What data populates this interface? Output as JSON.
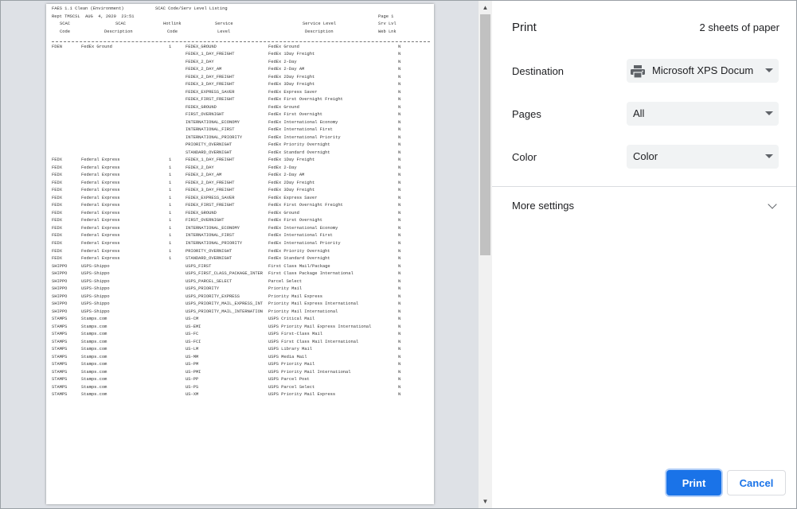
{
  "print_panel": {
    "title": "Print",
    "sheets": "2 sheets of paper",
    "destination": {
      "label": "Destination",
      "value": "Microsoft XPS Docum"
    },
    "pages": {
      "label": "Pages",
      "value": "All"
    },
    "color": {
      "label": "Color",
      "value": "Color"
    },
    "more_settings": "More settings",
    "print_button": "Print",
    "cancel_button": "Cancel"
  },
  "preview": {
    "header": {
      "line1_left": "FAES 1.1 Clean (Environment)",
      "line1_mid": "SCAC Code/Serv Level Listing",
      "line2_left": "Rept TMSCSL  AUG  4, 2020  23:51",
      "line2_right": "Page 1",
      "col1a": "SCAC",
      "col1b": "Code",
      "col2a": "SCAC",
      "col2b": "Description",
      "col3a": "Hotlink",
      "col3b": "Code",
      "col4a": "Service",
      "col4b": "Level",
      "col5a": "Service Level",
      "col5b": "Description",
      "col6a": "Srv Lvl",
      "col6b": "Web Lnk"
    },
    "rows": [
      {
        "code": "FDEN",
        "desc": "FedEx Ground",
        "hot": "1",
        "level": "FEDEX_GROUND",
        "sdesc": "FedEx Ground",
        "web": "N"
      },
      {
        "code": "",
        "desc": "",
        "hot": "",
        "level": "FEDEX_1_DAY_FREIGHT",
        "sdesc": "FedEx 1Day Freight",
        "web": "N"
      },
      {
        "code": "",
        "desc": "",
        "hot": "",
        "level": "FEDEX_2_DAY",
        "sdesc": "FedEx 2-Day",
        "web": "N"
      },
      {
        "code": "",
        "desc": "",
        "hot": "",
        "level": "FEDEX_2_DAY_AM",
        "sdesc": "FedEx 2-Day AM",
        "web": "N"
      },
      {
        "code": "",
        "desc": "",
        "hot": "",
        "level": "FEDEX_2_DAY_FREIGHT",
        "sdesc": "FedEx 2Day Freight",
        "web": "N"
      },
      {
        "code": "",
        "desc": "",
        "hot": "",
        "level": "FEDEX_3_DAY_FREIGHT",
        "sdesc": "FedEx 3Day Freight",
        "web": "N"
      },
      {
        "code": "",
        "desc": "",
        "hot": "",
        "level": "FEDEX_EXPRESS_SAVER",
        "sdesc": "FedEx Express Saver",
        "web": "N"
      },
      {
        "code": "",
        "desc": "",
        "hot": "",
        "level": "FEDEX_FIRST_FREIGHT",
        "sdesc": "FedEx First Overnight Freight",
        "web": "N"
      },
      {
        "code": "",
        "desc": "",
        "hot": "",
        "level": "FEDEX_GROUND",
        "sdesc": "FedEx Ground",
        "web": "N"
      },
      {
        "code": "",
        "desc": "",
        "hot": "",
        "level": "FIRST_OVERNIGHT",
        "sdesc": "FedEx First Overnight",
        "web": "N"
      },
      {
        "code": "",
        "desc": "",
        "hot": "",
        "level": "INTERNATIONAL_ECONOMY",
        "sdesc": "FedEx International Economy",
        "web": "N"
      },
      {
        "code": "",
        "desc": "",
        "hot": "",
        "level": "INTERNATIONAL_FIRST",
        "sdesc": "FedEx International First",
        "web": "N"
      },
      {
        "code": "",
        "desc": "",
        "hot": "",
        "level": "INTERNATIONAL_PRIORITY",
        "sdesc": "FedEx International Priority",
        "web": "N"
      },
      {
        "code": "",
        "desc": "",
        "hot": "",
        "level": "PRIORITY_OVERNIGHT",
        "sdesc": "FedEx Priority Overnight",
        "web": "N"
      },
      {
        "code": "",
        "desc": "",
        "hot": "",
        "level": "STANDARD_OVERNIGHT",
        "sdesc": "FedEx Standard Overnight",
        "web": "N"
      },
      {
        "code": "FEDX",
        "desc": "Federal Express",
        "hot": "1",
        "level": "FEDEX_1_DAY_FREIGHT",
        "sdesc": "FedEx 1Day Freight",
        "web": "N"
      },
      {
        "code": "FEDX",
        "desc": "Federal Express",
        "hot": "1",
        "level": "FEDEX_2_DAY",
        "sdesc": "FedEx 2-Day",
        "web": "N"
      },
      {
        "code": "FEDX",
        "desc": "Federal Express",
        "hot": "1",
        "level": "FEDEX_2_DAY_AM",
        "sdesc": "FedEx 2-Day AM",
        "web": "N"
      },
      {
        "code": "FEDX",
        "desc": "Federal Express",
        "hot": "1",
        "level": "FEDEX_2_DAY_FREIGHT",
        "sdesc": "FedEx 2Day Freight",
        "web": "N"
      },
      {
        "code": "FEDX",
        "desc": "Federal Express",
        "hot": "1",
        "level": "FEDEX_3_DAY_FREIGHT",
        "sdesc": "FedEx 3Day Freight",
        "web": "N"
      },
      {
        "code": "FEDX",
        "desc": "Federal Express",
        "hot": "1",
        "level": "FEDEX_EXPRESS_SAVER",
        "sdesc": "FedEx Express Saver",
        "web": "N"
      },
      {
        "code": "FEDX",
        "desc": "Federal Express",
        "hot": "1",
        "level": "FEDEX_FIRST_FREIGHT",
        "sdesc": "FedEx First Overnight Freight",
        "web": "N"
      },
      {
        "code": "FEDX",
        "desc": "Federal Express",
        "hot": "1",
        "level": "FEDEX_GROUND",
        "sdesc": "FedEx Ground",
        "web": "N"
      },
      {
        "code": "FEDX",
        "desc": "Federal Express",
        "hot": "1",
        "level": "FIRST_OVERNIGHT",
        "sdesc": "FedEx First Overnight",
        "web": "N"
      },
      {
        "code": "FEDX",
        "desc": "Federal Express",
        "hot": "1",
        "level": "INTERNATIONAL_ECONOMY",
        "sdesc": "FedEx International Economy",
        "web": "N"
      },
      {
        "code": "FEDX",
        "desc": "Federal Express",
        "hot": "1",
        "level": "INTERNATIONAL_FIRST",
        "sdesc": "FedEx International First",
        "web": "N"
      },
      {
        "code": "FEDX",
        "desc": "Federal Express",
        "hot": "1",
        "level": "INTERNATIONAL_PRIORITY",
        "sdesc": "FedEx International Priority",
        "web": "N"
      },
      {
        "code": "FEDX",
        "desc": "Federal Express",
        "hot": "1",
        "level": "PRIORITY_OVERNIGHT",
        "sdesc": "FedEx Priority Overnight",
        "web": "N"
      },
      {
        "code": "FEDX",
        "desc": "Federal Express",
        "hot": "1",
        "level": "STANDARD_OVERNIGHT",
        "sdesc": "FedEx Standard Overnight",
        "web": "N"
      },
      {
        "code": "SHIPPO",
        "desc": "USPS-Shippo",
        "hot": "",
        "level": "USPS_FIRST",
        "sdesc": "First Class Mail/Package",
        "web": "N"
      },
      {
        "code": "SHIPPO",
        "desc": "USPS-Shippo",
        "hot": "",
        "level": "USPS_FIRST_CLASS_PACKAGE_INTER",
        "sdesc": "First Class Package International",
        "web": "N"
      },
      {
        "code": "SHIPPO",
        "desc": "USPS-Shippo",
        "hot": "",
        "level": "USPS_PARCEL_SELECT",
        "sdesc": "Parcel Select",
        "web": "N"
      },
      {
        "code": "SHIPPO",
        "desc": "USPS-Shippo",
        "hot": "",
        "level": "USPS_PRIORITY",
        "sdesc": "Priority Mail",
        "web": "N"
      },
      {
        "code": "SHIPPO",
        "desc": "USPS-Shippo",
        "hot": "",
        "level": "USPS_PRIORITY_EXPRESS",
        "sdesc": "Priority Mail Express",
        "web": "N"
      },
      {
        "code": "SHIPPO",
        "desc": "USPS-Shippo",
        "hot": "",
        "level": "USPS_PRIORITY_MAIL_EXPRESS_INT",
        "sdesc": "Priority Mail Express International",
        "web": "N"
      },
      {
        "code": "SHIPPO",
        "desc": "USPS-Shippo",
        "hot": "",
        "level": "USPS_PRIORITY_MAIL_INTERNATION",
        "sdesc": "Priority Mail International",
        "web": "N"
      },
      {
        "code": "STAMPS",
        "desc": "Stamps.com",
        "hot": "",
        "level": "US-CM",
        "sdesc": "USPS Critical Mail",
        "web": "N"
      },
      {
        "code": "STAMPS",
        "desc": "Stamps.com",
        "hot": "",
        "level": "US-EMI",
        "sdesc": "USPS Priority Mail Express International",
        "web": "N"
      },
      {
        "code": "STAMPS",
        "desc": "Stamps.com",
        "hot": "",
        "level": "US-FC",
        "sdesc": "USPS First-Class Mail",
        "web": "N"
      },
      {
        "code": "STAMPS",
        "desc": "Stamps.com",
        "hot": "",
        "level": "US-FCI",
        "sdesc": "USPS First Class Mail International",
        "web": "N"
      },
      {
        "code": "STAMPS",
        "desc": "Stamps.com",
        "hot": "",
        "level": "US-LM",
        "sdesc": "USPS Library Mail",
        "web": "N"
      },
      {
        "code": "STAMPS",
        "desc": "Stamps.com",
        "hot": "",
        "level": "US-MM",
        "sdesc": "USPS Media Mail",
        "web": "N"
      },
      {
        "code": "STAMPS",
        "desc": "Stamps.com",
        "hot": "",
        "level": "US-PM",
        "sdesc": "USPS Priority Mail",
        "web": "N"
      },
      {
        "code": "STAMPS",
        "desc": "Stamps.com",
        "hot": "",
        "level": "US-PMI",
        "sdesc": "USPS Priority Mail International",
        "web": "N"
      },
      {
        "code": "STAMPS",
        "desc": "Stamps.com",
        "hot": "",
        "level": "US-PP",
        "sdesc": "USPS Parcel Post",
        "web": "N"
      },
      {
        "code": "STAMPS",
        "desc": "Stamps.com",
        "hot": "",
        "level": "US-PS",
        "sdesc": "USPS Parcel Select",
        "web": "N"
      },
      {
        "code": "STAMPS",
        "desc": "Stamps.com",
        "hot": "",
        "level": "US-XM",
        "sdesc": "USPS Priority Mail Express",
        "web": "N"
      }
    ]
  }
}
